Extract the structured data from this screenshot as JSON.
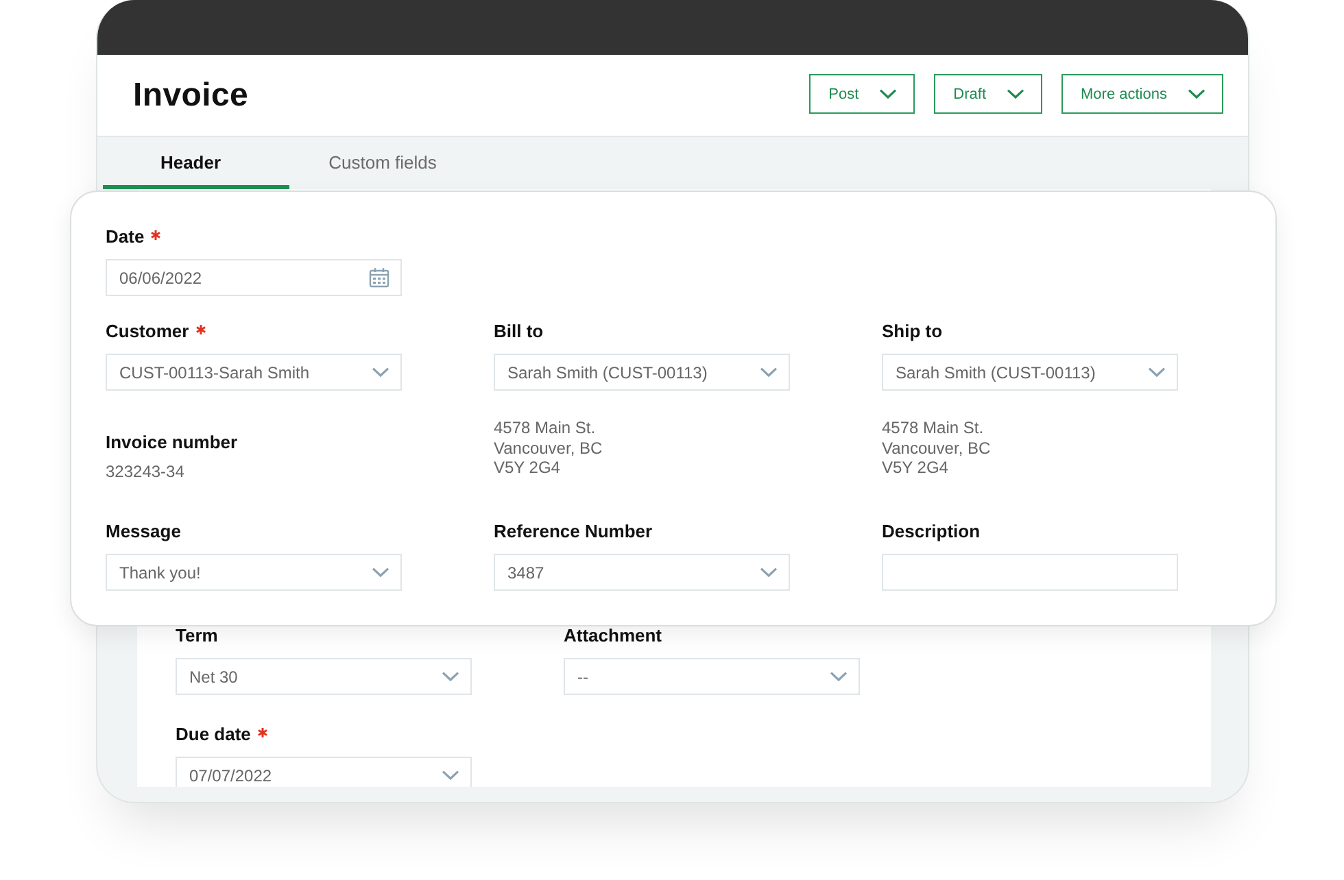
{
  "window": {
    "title": "Invoice"
  },
  "actions": [
    {
      "label": "Post"
    },
    {
      "label": "Draft"
    },
    {
      "label": "More actions"
    }
  ],
  "tabs": [
    {
      "label": "Header",
      "selected": true
    },
    {
      "label": "Custom fields",
      "selected": false
    }
  ],
  "form": {
    "rows": [
      [
        {
          "kind": "date",
          "label": "Date",
          "required": true,
          "value": "06/06/2022"
        }
      ],
      [
        {
          "kind": "select",
          "label": "Customer",
          "required": true,
          "value": "CUST-00113-Sarah Smith"
        },
        {
          "kind": "select",
          "label": "Bill to",
          "required": false,
          "value": "Sarah Smith (CUST-00113)"
        },
        {
          "kind": "select",
          "label": "Ship to",
          "required": false,
          "value": "Sarah Smith (CUST-00113)"
        }
      ],
      [
        {
          "kind": "readonly",
          "label": "Invoice number",
          "required": false,
          "value": "323243-34"
        },
        {
          "kind": "address",
          "lines": [
            "4578 Main St.",
            "Vancouver, BC",
            "V5Y 2G4"
          ]
        },
        {
          "kind": "address",
          "lines": [
            "4578 Main St.",
            "Vancouver, BC",
            "V5Y 2G4"
          ]
        }
      ],
      [
        {
          "kind": "select",
          "label": "Message",
          "required": false,
          "value": "Thank you!"
        },
        {
          "kind": "select",
          "label": "Reference Number",
          "required": false,
          "value": "3487"
        },
        {
          "kind": "text",
          "label": "Description",
          "required": false
        }
      ]
    ]
  },
  "more_fields": {
    "rows": [
      [
        {
          "kind": "select",
          "label": "Term",
          "required": false,
          "value": "Net 30"
        },
        {
          "kind": "select",
          "label": "Attachment",
          "required": false,
          "value": "--"
        }
      ],
      [
        {
          "kind": "select",
          "label": "Due date",
          "required": true,
          "value": "07/07/2022"
        }
      ]
    ]
  }
}
